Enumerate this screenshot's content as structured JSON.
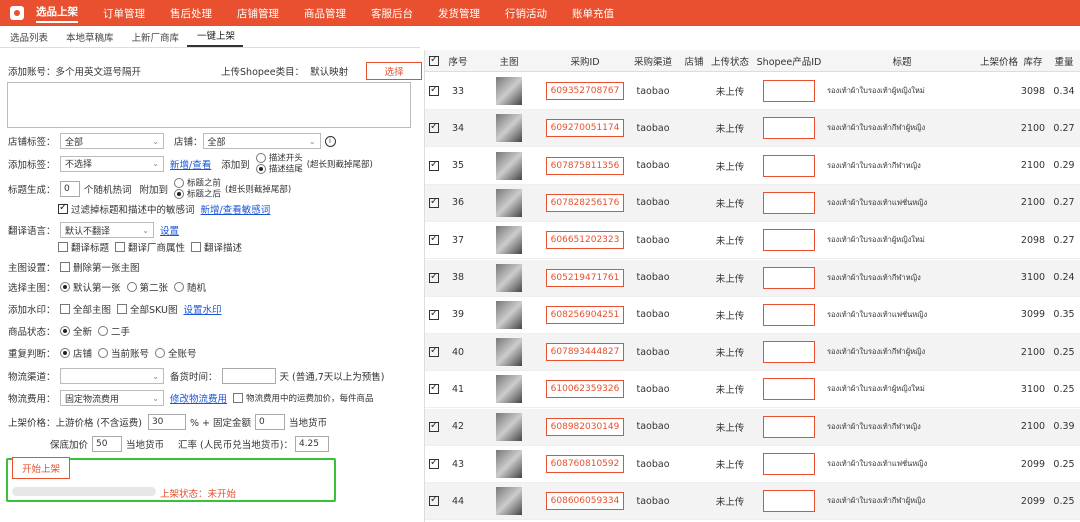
{
  "nav": {
    "items": [
      "选品上架",
      "订单管理",
      "售后处理",
      "店铺管理",
      "商品管理",
      "客服后台",
      "发货管理",
      "行销活动",
      "账单充值"
    ]
  },
  "subtabs": [
    "选品列表",
    "本地草稿库",
    "上新厂商库",
    "一键上架"
  ],
  "form": {
    "add_account_label": "添加账号：",
    "add_account_value": "多个用英文逗号隔开",
    "shopee_label": "上传Shopee类目：",
    "shopee_value": "默认映射",
    "choose_button": "选择",
    "store_tag_label": "店铺标签：",
    "store_tag_value": "全部",
    "store_label": "店铺：",
    "store_value": "全部",
    "add_keyword_label": "添加标签：",
    "add_keyword_value": "不选择",
    "new_view_link": "新增/查看",
    "add_to_label": "添加到",
    "title_front": "描述开头",
    "title_end": "描述结尾",
    "title_note": "(超长则截掉尾部)",
    "title_gen_label": "标题生成：",
    "title_gen_count": "0",
    "title_gen_mid": "个随机热词",
    "append_to": "附加到",
    "before_title": "标题之前",
    "after_title": "标题之后",
    "title_gen_note": "(超长则截掉尾部)",
    "filter_sensitive": "过滤掉标题和描述中的敏感词",
    "sensitive_link": "新增/查看敏感词",
    "translate_label": "翻译语言：",
    "translate_value": "默认不翻译",
    "setting_link": "设置",
    "translate_opt1": "翻译标题",
    "translate_opt2": "翻译厂商属性",
    "translate_opt3": "翻译描述",
    "main_img_label": "主图设置：",
    "main_img_opt": "删除第一张主图",
    "select_main_label": "选择主图：",
    "select_main_opts": [
      "默认第一张",
      "第二张",
      "随机"
    ],
    "watermark_label": "添加水印：",
    "watermark_opt1": "全部主图",
    "watermark_opt2": "全部SKU图",
    "watermark_link": "设置水印",
    "desc_label": "商品状态：",
    "desc_opts": [
      "全新",
      "二手"
    ],
    "repeat_label": "重复判断：",
    "repeat_opts": [
      "店铺",
      "当前账号",
      "全账号"
    ],
    "logistics_label": "物流渠道：",
    "stock_label": "备货时间：",
    "stock_unit": "天 (普通,7天以上为预售)",
    "shipping_label": "物流费用：",
    "shipping_value": "固定物流费用",
    "shipping_link": "修改物流费用",
    "shipping_note": "物流费用中的运费加价，每件商品",
    "price_label": "上架价格：",
    "price_desc": "上游价格 (不含运费)",
    "price_value": "30",
    "price_mid": "% + 固定金额",
    "price_fixed": "0",
    "price_unit": "当地货币",
    "min_profit_label": "保底加价",
    "min_profit_value": "50",
    "min_profit_unit": "当地货币",
    "rate_label": "汇率 (人民币兑当地货币)：",
    "rate_value": "4.25",
    "start_button": "开始上架",
    "status_label": "上架状态：",
    "status_value": "未开始"
  },
  "table": {
    "headers": [
      "序号",
      "主图",
      "采购ID",
      "采购渠道",
      "店铺",
      "上传状态",
      "Shopee产品ID",
      "标题",
      "上架价格",
      "库存",
      "重量"
    ],
    "rows": [
      {
        "no": "33",
        "id": "609352708767",
        "channel": "taobao",
        "status": "未上传",
        "title": "รองเท้าผ้าใบรองเท้าผู้หญิงใหม่",
        "stock": "3098",
        "weight": "0.34"
      },
      {
        "no": "34",
        "id": "609270051174",
        "channel": "taobao",
        "status": "未上传",
        "title": "รองเท้าผ้าใบรองเท้ากีฬาผู้หญิง",
        "stock": "2100",
        "weight": "0.27"
      },
      {
        "no": "35",
        "id": "607875811356",
        "channel": "taobao",
        "status": "未上传",
        "title": "รองเท้าผ้าใบรองเท้ากีฬาหญิง",
        "stock": "2100",
        "weight": "0.29"
      },
      {
        "no": "36",
        "id": "607828256176",
        "channel": "taobao",
        "status": "未上传",
        "title": "รองเท้าผ้าใบรองเท้าแฟชั่นหญิง",
        "stock": "2100",
        "weight": "0.27"
      },
      {
        "no": "37",
        "id": "606651202323",
        "channel": "taobao",
        "status": "未上传",
        "title": "รองเท้าผ้าใบรองเท้าผู้หญิงใหม่",
        "stock": "2098",
        "weight": "0.27"
      },
      {
        "no": "38",
        "id": "605219471761",
        "channel": "taobao",
        "status": "未上传",
        "title": "รองเท้าผ้าใบรองเท้ากีฬาหญิง",
        "stock": "3100",
        "weight": "0.24"
      },
      {
        "no": "39",
        "id": "608256904251",
        "channel": "taobao",
        "status": "未上传",
        "title": "รองเท้าผ้าใบรองเท้าแฟชั่นหญิง",
        "stock": "3099",
        "weight": "0.35"
      },
      {
        "no": "40",
        "id": "607893444827",
        "channel": "taobao",
        "status": "未上传",
        "title": "รองเท้าผ้าใบรองเท้ากีฬาผู้หญิง",
        "stock": "2100",
        "weight": "0.25"
      },
      {
        "no": "41",
        "id": "610062359326",
        "channel": "taobao",
        "status": "未上传",
        "title": "รองเท้าผ้าใบรองเท้าผู้หญิงใหม่",
        "stock": "3100",
        "weight": "0.25"
      },
      {
        "no": "42",
        "id": "608982030149",
        "channel": "taobao",
        "status": "未上传",
        "title": "รองเท้าผ้าใบรองเท้ากีฬาหญิง",
        "stock": "2100",
        "weight": "0.39"
      },
      {
        "no": "43",
        "id": "608760810592",
        "channel": "taobao",
        "status": "未上传",
        "title": "รองเท้าผ้าใบรองเท้าแฟชั่นหญิง",
        "stock": "2099",
        "weight": "0.25"
      },
      {
        "no": "44",
        "id": "608606059334",
        "channel": "taobao",
        "status": "未上传",
        "title": "รองเท้าผ้าใบรองเท้ากีฬาผู้หญิง",
        "stock": "2099",
        "weight": "0.25"
      }
    ]
  }
}
